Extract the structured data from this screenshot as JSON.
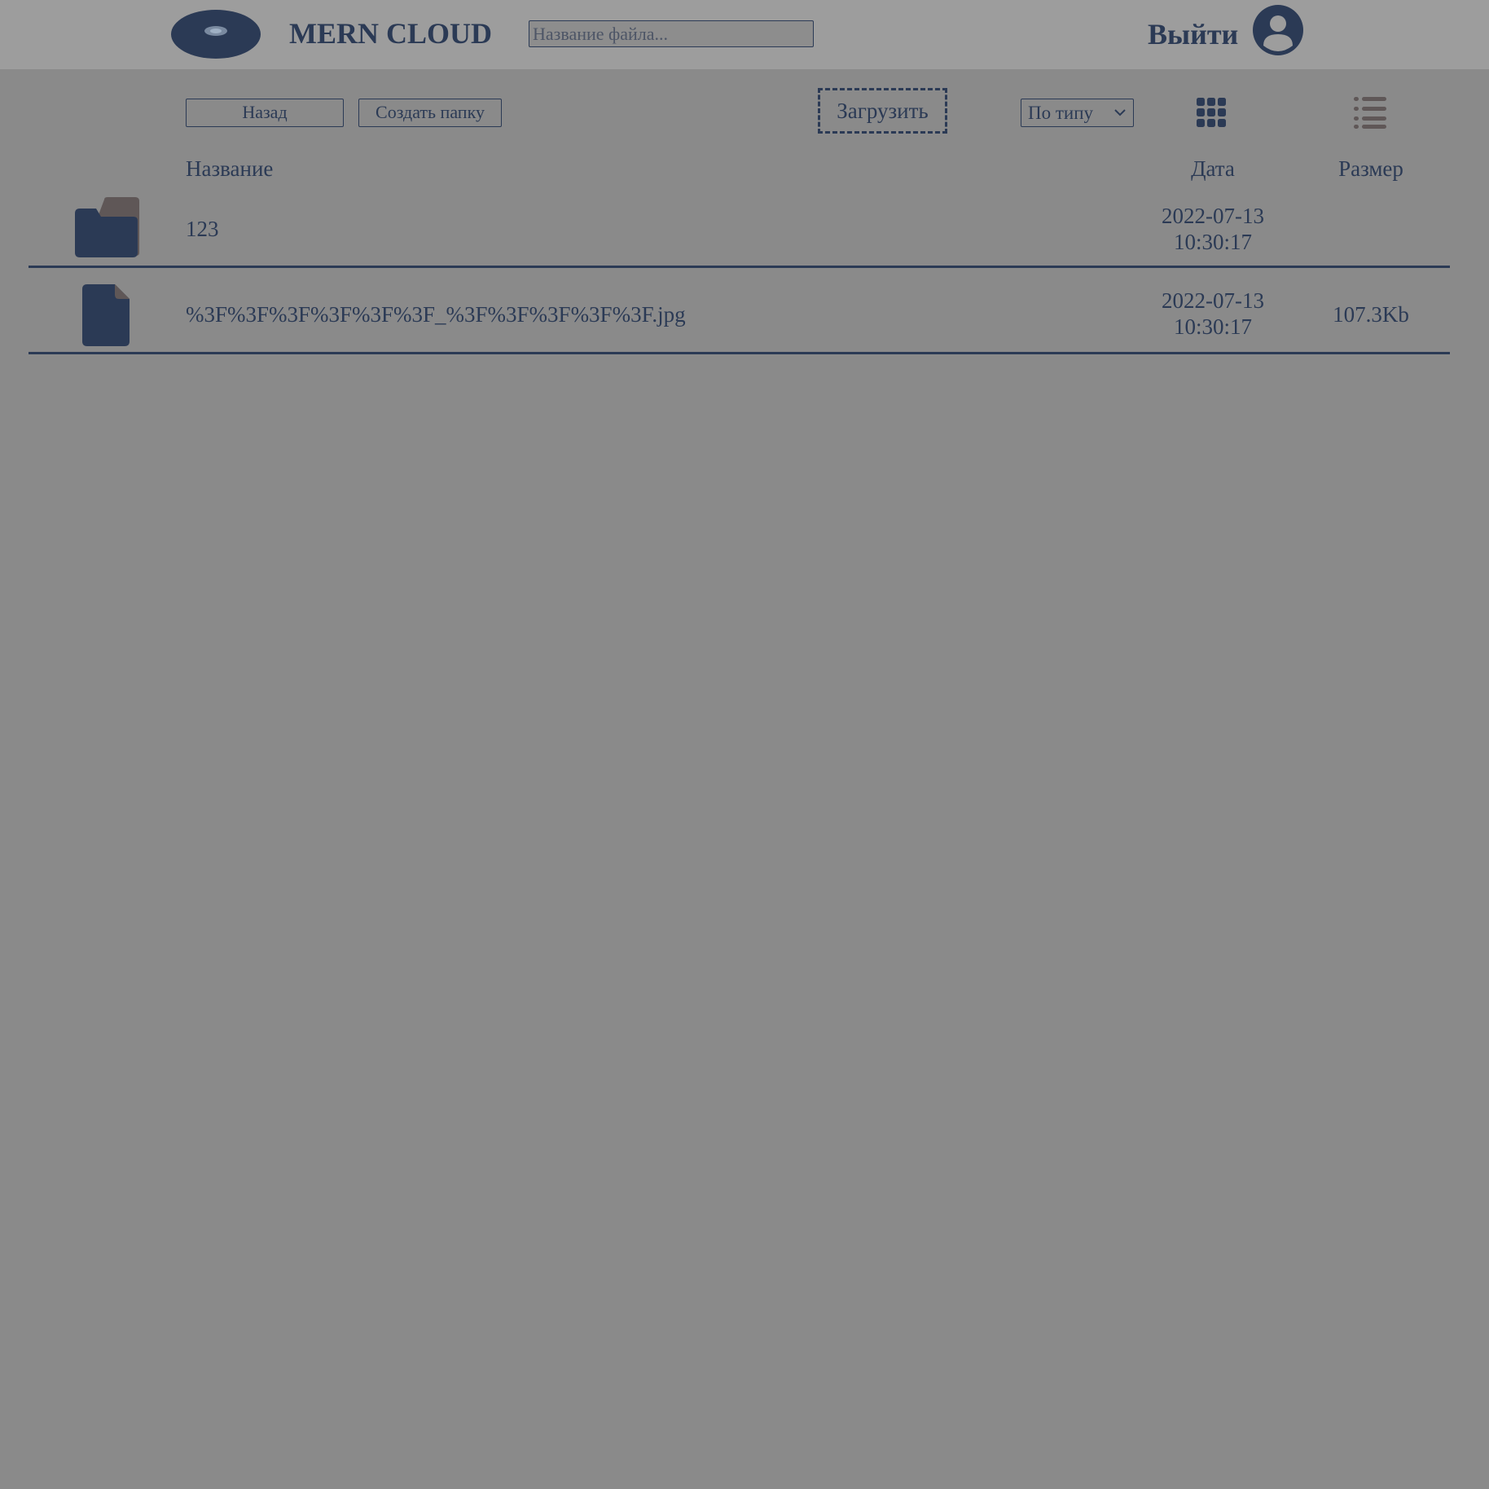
{
  "header": {
    "app_title": "MERN CLOUD",
    "search": {
      "placeholder": "Название файла...",
      "value": ""
    },
    "logout_label": "Выйти",
    "logo_icon": "disk-icon",
    "avatar_icon": "user-avatar-icon"
  },
  "toolbar": {
    "back_label": "Назад",
    "create_folder_label": "Создать папку",
    "upload_label": "Загрузить",
    "sort_selected": "По типу",
    "grid_view_icon": "grid-view-icon",
    "list_view_icon": "list-view-icon"
  },
  "table": {
    "columns": {
      "name": "Название",
      "date": "Дата",
      "size": "Размер"
    },
    "rows": [
      {
        "type": "folder",
        "icon": "folder-icon",
        "name": "123",
        "date": "2022-07-13",
        "time": "10:30:17",
        "size": ""
      },
      {
        "type": "file",
        "icon": "file-icon",
        "name": "%3F%3F%3F%3F%3F%3F_%3F%3F%3F%3F%3F.jpg",
        "date": "2022-07-13",
        "time": "10:30:17",
        "size": "107.3Kb"
      }
    ]
  },
  "colors": {
    "primary": "#2b3a55",
    "background": "#8a8a8a",
    "navbar": "#9d9d9d",
    "muted_icon": "#5f5757"
  }
}
